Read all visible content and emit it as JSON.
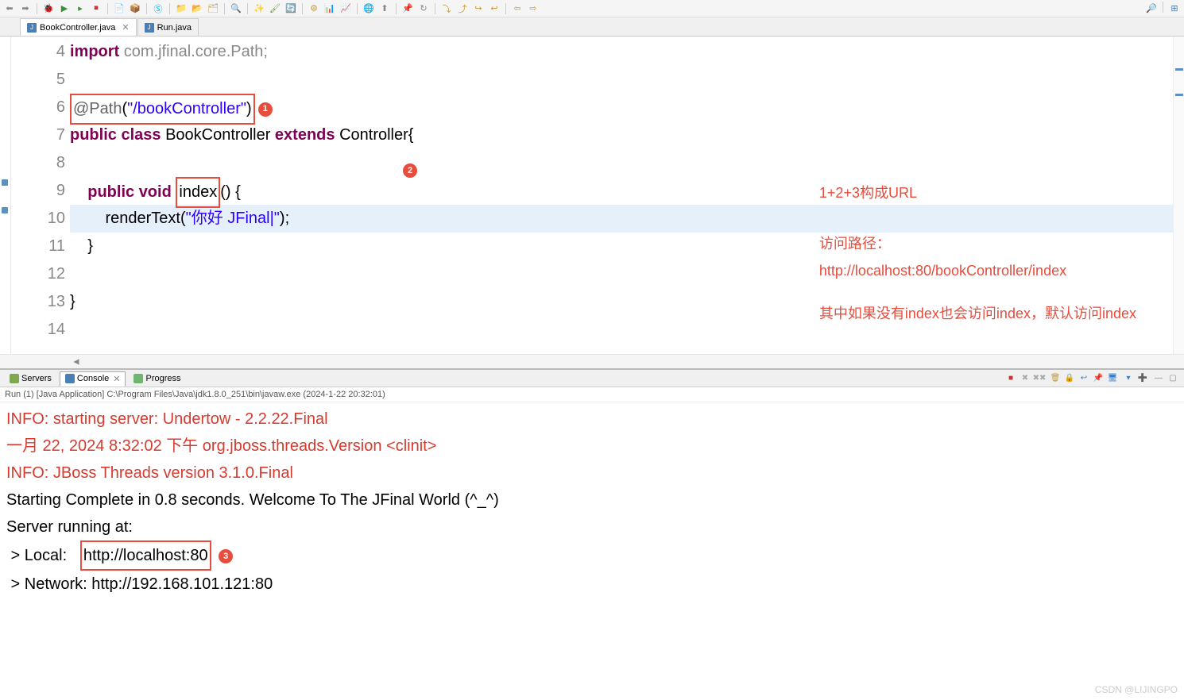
{
  "tabs": {
    "file1": "BookController.java",
    "file2": "Run.java"
  },
  "gutter": [
    "4",
    "5",
    "6",
    "7",
    "8",
    "9",
    "10",
    "11",
    "12",
    "13",
    "14"
  ],
  "code": {
    "l4_import": "import",
    "l4_rest": " com.jfinal.core.Path;",
    "l6_ann": "@Path",
    "l6_args": "(\"/bookController\")",
    "l7_public": "public ",
    "l7_class": "class",
    "l7_name": " BookController ",
    "l7_ext": "extends",
    "l7_ctrl": " Controller{",
    "l9_pub": "public ",
    "l9_void": "void",
    "l9_index": "index",
    "l9_paren": "() {",
    "l10_call": "renderText(",
    "l10_str": "\"你好 JFinal|\"",
    "l10_end": ");",
    "l11": "}",
    "l13": "}"
  },
  "badges": {
    "b1": "1",
    "b2": "2",
    "b3": "3"
  },
  "notes": {
    "n1": "1+2+3构成URL",
    "n2": "访问路径：",
    "n3": "http://localhost:80/bookController/index",
    "n4": "其中如果没有index也会访问index，默认访问index"
  },
  "views": {
    "servers": "Servers",
    "console": "Console",
    "progress": "Progress"
  },
  "runinfo": "Run (1) [Java Application] C:\\Program Files\\Java\\jdk1.8.0_251\\bin\\javaw.exe  (2024-1-22 20:32:01)",
  "console": {
    "l1": "INFO: starting server: Undertow - 2.2.22.Final",
    "l2": "一月 22, 2024 8:32:02 下午 org.jboss.threads.Version <clinit>",
    "l3": "INFO: JBoss Threads version 3.1.0.Final",
    "l4": "Starting Complete in 0.8 seconds. Welcome To The JFinal World (^_^)",
    "l5": "",
    "l6": "Server running at:",
    "l7a": " > Local:   ",
    "l7b": "http://localhost:80",
    "l8": " > Network: http://192.168.101.121:80"
  },
  "watermark": "CSDN @LIJINGPO"
}
